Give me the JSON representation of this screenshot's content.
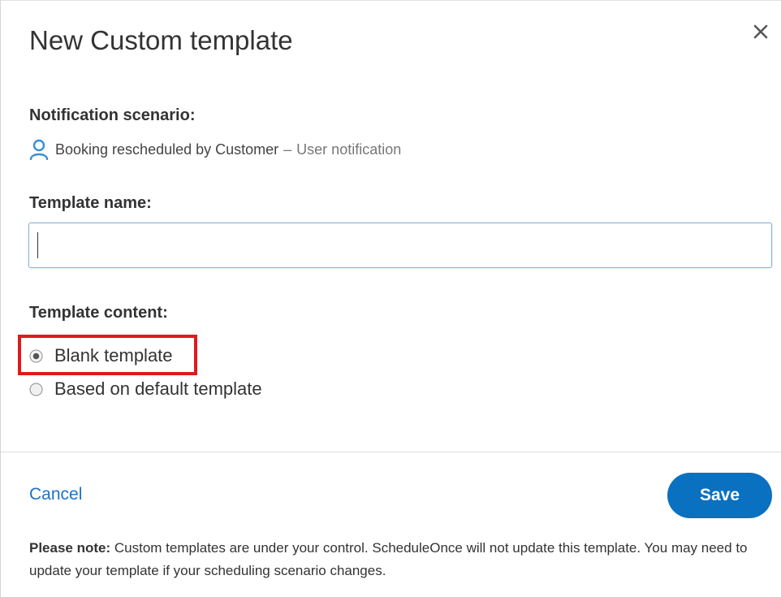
{
  "dialog": {
    "title": "New Custom template",
    "close_icon": "close-icon"
  },
  "scenario": {
    "label": "Notification scenario:",
    "icon": "user-icon",
    "name": "Booking rescheduled by Customer",
    "separator": "–",
    "type": "User notification"
  },
  "template_name": {
    "label": "Template name:",
    "value": "",
    "placeholder": ""
  },
  "template_content": {
    "label": "Template content:",
    "options": [
      {
        "label": "Blank template",
        "selected": true
      },
      {
        "label": "Based on default template",
        "selected": false
      }
    ]
  },
  "footer": {
    "cancel_label": "Cancel",
    "save_label": "Save",
    "note_bold": "Please note:",
    "note_text": " Custom templates are under your control. ScheduleOnce will not update this template. You may need to update your template if your scheduling scenario changes."
  },
  "colors": {
    "accent": "#0a70c0",
    "link": "#1a73c7",
    "highlight": "#e0191f",
    "user_icon": "#3a8fd6"
  }
}
